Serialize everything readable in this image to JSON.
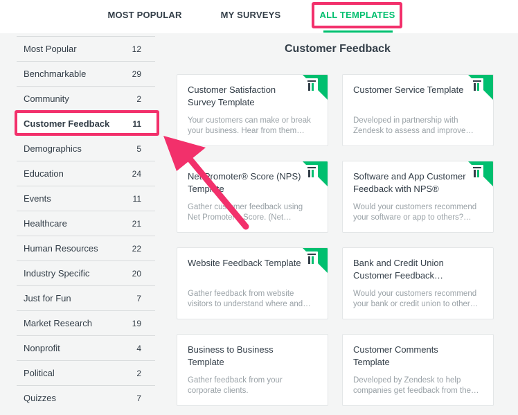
{
  "tabs": {
    "most_popular": "MOST POPULAR",
    "my_surveys": "MY SURVEYS",
    "all_templates": "ALL TEMPLATES"
  },
  "sidebar": {
    "items": [
      {
        "label": "Most Popular",
        "count": "12"
      },
      {
        "label": "Benchmarkable",
        "count": "29"
      },
      {
        "label": "Community",
        "count": "2"
      },
      {
        "label": "Customer Feedback",
        "count": "11"
      },
      {
        "label": "Demographics",
        "count": "5"
      },
      {
        "label": "Education",
        "count": "24"
      },
      {
        "label": "Events",
        "count": "11"
      },
      {
        "label": "Healthcare",
        "count": "21"
      },
      {
        "label": "Human Resources",
        "count": "22"
      },
      {
        "label": "Industry Specific",
        "count": "20"
      },
      {
        "label": "Just for Fun",
        "count": "7"
      },
      {
        "label": "Market Research",
        "count": "19"
      },
      {
        "label": "Nonprofit",
        "count": "4"
      },
      {
        "label": "Political",
        "count": "2"
      },
      {
        "label": "Quizzes",
        "count": "7"
      }
    ]
  },
  "main": {
    "title": "Customer Feedback",
    "cards": [
      {
        "title": "Customer Satisfaction Survey Template",
        "desc": "Your customers can make or break your business. Hear from them…",
        "benchmark": true
      },
      {
        "title": "Customer Service Template",
        "desc": "Developed in partnership with Zendesk to assess and improve…",
        "benchmark": true
      },
      {
        "title": "Net Promoter® Score (NPS) Template",
        "desc": "Gather customer feedback using Net Promoter® Score. (Net…",
        "benchmark": true
      },
      {
        "title": "Software and App Customer Feedback with NPS®",
        "desc": "Would your customers recommend your software or app to others?…",
        "benchmark": true
      },
      {
        "title": "Website Feedback Template",
        "desc": "Gather feedback from website visitors to understand where and…",
        "benchmark": true
      },
      {
        "title": "Bank and Credit Union Customer Feedback…",
        "desc": "Would your customers recommend your bank or credit union to other…",
        "benchmark": false
      },
      {
        "title": "Business to Business Template",
        "desc": "Gather feedback from your corporate clients.",
        "benchmark": false
      },
      {
        "title": "Customer Comments Template",
        "desc": "Developed by Zendesk to help companies get feedback from the…",
        "benchmark": false
      }
    ]
  },
  "colors": {
    "accent": "#00bf6f",
    "highlight": "#f2306b",
    "text": "#333e48",
    "muted": "#9aa2a7"
  }
}
